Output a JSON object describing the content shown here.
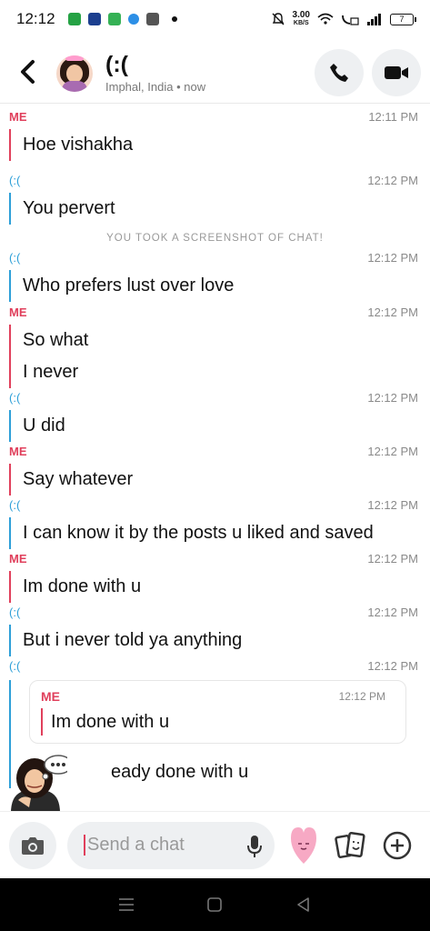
{
  "status_bar": {
    "time": "12:12",
    "net_speed": "3.00",
    "net_unit": "KB/S",
    "battery": "7"
  },
  "header": {
    "contact_name": "(:(",
    "location": "Imphal, India",
    "last_seen": "now",
    "separator": "•"
  },
  "messages": [
    {
      "sender": "ME",
      "type": "me",
      "time": "12:11 PM",
      "lines": [
        "Hoe vishakha"
      ]
    },
    {
      "sender": "(:(",
      "type": "them",
      "time": "12:12 PM",
      "lines": [
        "You pervert"
      ]
    },
    {
      "sender": "(:(",
      "type": "them",
      "time": "12:12 PM",
      "lines": [
        "Who prefers lust over love"
      ]
    },
    {
      "sender": "ME",
      "type": "me",
      "time": "12:12 PM",
      "lines": [
        "So what",
        "I never"
      ]
    },
    {
      "sender": "(:(",
      "type": "them",
      "time": "12:12 PM",
      "lines": [
        "U did"
      ]
    },
    {
      "sender": "ME",
      "type": "me",
      "time": "12:12 PM",
      "lines": [
        "Say whatever"
      ]
    },
    {
      "sender": "(:(",
      "type": "them",
      "time": "12:12 PM",
      "lines": [
        "I can know it by the posts u liked and saved"
      ]
    },
    {
      "sender": "ME",
      "type": "me",
      "time": "12:12 PM",
      "lines": [
        "Im done with u"
      ]
    },
    {
      "sender": "(:(",
      "type": "them",
      "time": "12:12 PM",
      "lines": [
        "But i never told ya anything"
      ]
    }
  ],
  "screenshot_notice": "YOU TOOK A SCREENSHOT OF CHAT!",
  "reply": {
    "sender": "(:(",
    "time": "12:12 PM",
    "quoted_sender": "ME",
    "quoted_time": "12:12 PM",
    "quoted_text": "Im done with u",
    "text": "I already done with u",
    "visible_text": "eady done with u"
  },
  "input": {
    "placeholder": "Send a chat"
  },
  "icons": {
    "back": "back-arrow-icon",
    "call": "phone-icon",
    "video": "video-camera-icon",
    "camera": "camera-icon",
    "mic": "microphone-icon",
    "heart": "heart-sticker-icon",
    "cards": "stickers-icon",
    "plus": "plus-icon"
  },
  "colors": {
    "me": "#e0405c",
    "them": "#2d9fd8"
  }
}
